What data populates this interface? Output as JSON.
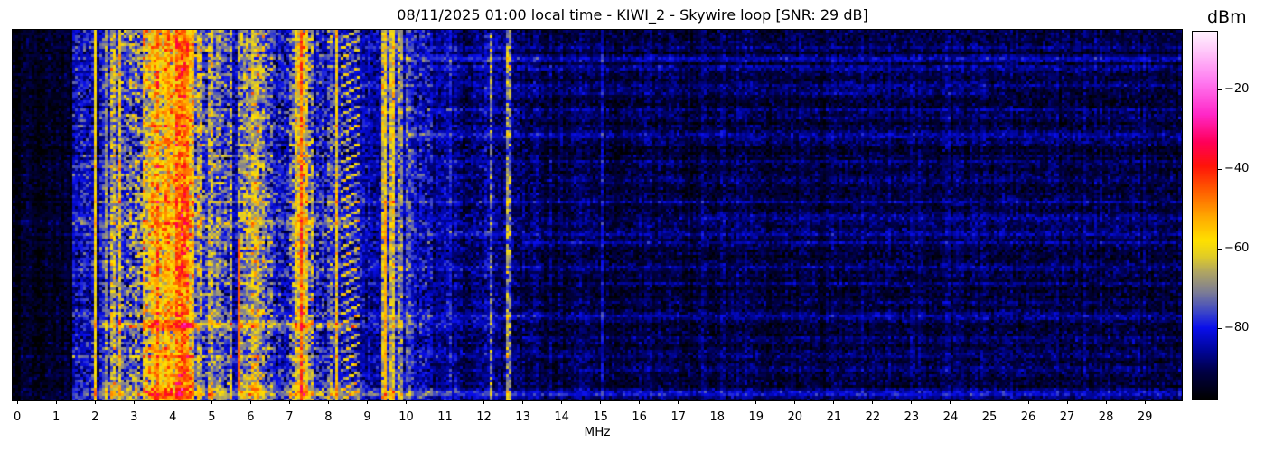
{
  "chart_data": {
    "type": "heatmap",
    "title": "08/11/2025 01:00 local time - KIWI_2 - Skywire loop [SNR: 29 dB]",
    "xlabel": "MHz",
    "ylabel": "",
    "x_range": [
      -0.12,
      29.95
    ],
    "x_ticks": [
      0,
      1,
      2,
      3,
      4,
      5,
      6,
      7,
      8,
      9,
      10,
      11,
      12,
      13,
      14,
      15,
      16,
      17,
      18,
      19,
      20,
      21,
      22,
      23,
      24,
      25,
      26,
      27,
      28,
      29
    ],
    "colorbar": {
      "label": "dBm",
      "vmax": -5.2,
      "vmin": -98,
      "ticks": [
        {
          "value": -20,
          "label": "−20"
        },
        {
          "value": -40,
          "label": "−40"
        },
        {
          "value": -60,
          "label": "−60"
        },
        {
          "value": -80,
          "label": "−80"
        }
      ]
    },
    "colormap_stops": [
      [
        -98,
        0,
        0,
        0
      ],
      [
        -91,
        0,
        0,
        70
      ],
      [
        -86,
        0,
        5,
        150
      ],
      [
        -80,
        10,
        15,
        235
      ],
      [
        -76,
        60,
        70,
        200
      ],
      [
        -71,
        125,
        125,
        150
      ],
      [
        -66,
        175,
        165,
        100
      ],
      [
        -62,
        225,
        205,
        40
      ],
      [
        -58,
        255,
        225,
        0
      ],
      [
        -52,
        255,
        170,
        0
      ],
      [
        -45,
        255,
        90,
        0
      ],
      [
        -39,
        255,
        20,
        10
      ],
      [
        -33,
        255,
        0,
        90
      ],
      [
        -26,
        255,
        40,
        200
      ],
      [
        -18,
        255,
        120,
        240
      ],
      [
        -10,
        255,
        200,
        250
      ],
      [
        -5,
        255,
        245,
        255
      ]
    ],
    "noise": {
      "seed": 77,
      "cell": 3,
      "background_base": -92,
      "background_var": 3,
      "active_fade_range": [
        1.38,
        8.8
      ],
      "fade_weight_active": 1.0,
      "fade_weight_quiet": 0.4
    },
    "bands": [
      [
        -0.2,
        1.38,
        -95,
        2.5
      ],
      [
        1.38,
        1.95,
        -82,
        5
      ],
      [
        1.95,
        2.04,
        -59,
        2
      ],
      [
        2.04,
        2.14,
        -90,
        3
      ],
      [
        2.14,
        2.25,
        -81,
        5
      ],
      [
        2.25,
        2.3,
        -72,
        4
      ],
      [
        2.3,
        2.42,
        -79,
        6
      ],
      [
        2.42,
        2.5,
        -65,
        7
      ],
      [
        2.5,
        2.58,
        -76,
        7
      ],
      [
        2.58,
        2.66,
        -64,
        7
      ],
      [
        2.66,
        2.8,
        -78,
        7
      ],
      [
        2.8,
        3.0,
        -73,
        8
      ],
      [
        3.0,
        3.1,
        -68,
        8
      ],
      [
        3.1,
        3.22,
        -74,
        8
      ],
      [
        3.22,
        3.42,
        -62,
        8
      ],
      [
        3.42,
        3.56,
        -57,
        7
      ],
      [
        3.56,
        3.64,
        -50,
        6
      ],
      [
        3.64,
        3.78,
        -60,
        7
      ],
      [
        3.78,
        3.9,
        -52,
        6
      ],
      [
        3.9,
        4.05,
        -58,
        7
      ],
      [
        4.05,
        4.38,
        -47,
        6
      ],
      [
        4.38,
        4.52,
        -56,
        7
      ],
      [
        4.52,
        4.64,
        -77,
        7
      ],
      [
        4.64,
        4.72,
        -66,
        7
      ],
      [
        4.72,
        4.9,
        -78,
        7
      ],
      [
        4.9,
        5.0,
        -68,
        7
      ],
      [
        5.0,
        5.1,
        -75,
        7
      ],
      [
        5.1,
        5.24,
        -70,
        6
      ],
      [
        5.24,
        5.42,
        -77,
        7
      ],
      [
        5.42,
        5.52,
        -70,
        7
      ],
      [
        5.52,
        5.68,
        -85,
        4
      ],
      [
        5.68,
        5.9,
        -71,
        7
      ],
      [
        5.9,
        6.04,
        -69,
        7
      ],
      [
        6.04,
        6.22,
        -63,
        7
      ],
      [
        6.22,
        6.38,
        -68,
        8
      ],
      [
        6.38,
        6.55,
        -76,
        8
      ],
      [
        6.55,
        6.95,
        -81,
        6
      ],
      [
        6.95,
        7.12,
        -75,
        7
      ],
      [
        7.12,
        7.26,
        -60,
        6
      ],
      [
        7.26,
        7.34,
        -46,
        5
      ],
      [
        7.34,
        7.44,
        -60,
        7
      ],
      [
        7.44,
        7.62,
        -70,
        8
      ],
      [
        7.62,
        7.92,
        -81,
        6
      ],
      [
        7.92,
        8.06,
        -76,
        7
      ],
      [
        8.06,
        8.11,
        -60,
        4
      ],
      [
        8.11,
        8.15,
        -78,
        5
      ],
      [
        8.15,
        8.22,
        -58,
        5
      ],
      [
        8.22,
        8.28,
        -80,
        5
      ],
      [
        8.28,
        8.78,
        -80,
        5,
        "diag"
      ],
      [
        8.78,
        9.32,
        -86,
        4
      ],
      [
        9.32,
        9.4,
        -64,
        6
      ],
      [
        9.4,
        9.44,
        -76,
        5
      ],
      [
        9.44,
        9.52,
        -62,
        5
      ],
      [
        9.52,
        9.58,
        -78,
        5
      ],
      [
        9.58,
        9.66,
        -63,
        6
      ],
      [
        9.66,
        9.74,
        -80,
        5
      ],
      [
        9.74,
        9.8,
        -68,
        6
      ],
      [
        9.8,
        9.86,
        -80,
        5
      ],
      [
        9.86,
        9.92,
        -70,
        6
      ],
      [
        9.92,
        10.0,
        -84,
        4
      ],
      [
        10.0,
        10.08,
        -76,
        5
      ],
      [
        10.08,
        10.22,
        -80,
        5
      ],
      [
        10.22,
        10.65,
        -84,
        5
      ],
      [
        10.65,
        11.05,
        -88,
        3.5
      ],
      [
        11.05,
        11.15,
        -84,
        4
      ],
      [
        11.15,
        11.95,
        -89,
        3.5
      ],
      [
        11.95,
        12.12,
        -87,
        4
      ],
      [
        12.12,
        12.2,
        -72,
        6
      ],
      [
        12.2,
        12.58,
        -89,
        3.5
      ],
      [
        12.58,
        12.66,
        -71,
        7
      ],
      [
        12.66,
        13.1,
        -90,
        3.5
      ],
      [
        13.1,
        13.4,
        -89,
        3.5
      ],
      [
        13.4,
        14.96,
        -92,
        3
      ],
      [
        14.96,
        15.04,
        -87,
        3
      ],
      [
        15.04,
        17.56,
        -92,
        3
      ],
      [
        17.56,
        17.64,
        -88,
        3
      ],
      [
        17.64,
        29.96,
        -92,
        3
      ]
    ],
    "streaks": [
      [
        0.045,
        9.0,
        29.95,
        4
      ],
      [
        0.075,
        10.0,
        29.95,
        8
      ],
      [
        0.1,
        10.5,
        29.95,
        5
      ],
      [
        0.145,
        8.7,
        29.95,
        4
      ],
      [
        0.165,
        12.0,
        25.0,
        4
      ],
      [
        0.21,
        9.0,
        29.95,
        6
      ],
      [
        0.235,
        13.0,
        29.95,
        4
      ],
      [
        0.28,
        9.5,
        29.95,
        7
      ],
      [
        0.3,
        16.0,
        29.95,
        4
      ],
      [
        0.35,
        10.0,
        29.95,
        4
      ],
      [
        0.4,
        13.5,
        29.95,
        4
      ],
      [
        0.46,
        2.0,
        29.95,
        6
      ],
      [
        0.5,
        17.0,
        29.95,
        4
      ],
      [
        0.545,
        10.2,
        29.95,
        5
      ],
      [
        0.57,
        13.0,
        29.95,
        6
      ],
      [
        0.635,
        9.0,
        29.95,
        5
      ],
      [
        0.68,
        15.0,
        29.95,
        4
      ],
      [
        0.73,
        11.0,
        29.95,
        4
      ],
      [
        0.77,
        9.0,
        29.95,
        6
      ],
      [
        0.793,
        1.9,
        8.7,
        14
      ],
      [
        0.793,
        8.7,
        12.5,
        5
      ],
      [
        0.83,
        13.0,
        29.95,
        4
      ],
      [
        0.87,
        10.0,
        29.95,
        5
      ],
      [
        0.91,
        14.0,
        29.95,
        4
      ],
      [
        0.955,
        2.0,
        9.0,
        7
      ],
      [
        0.975,
        2.0,
        29.95,
        9
      ]
    ],
    "segments": [
      [
        5.705,
        0.05,
        0.56,
        0.97,
        -46
      ],
      [
        9.475,
        0.06,
        0.45,
        1.0,
        -53
      ]
    ]
  }
}
